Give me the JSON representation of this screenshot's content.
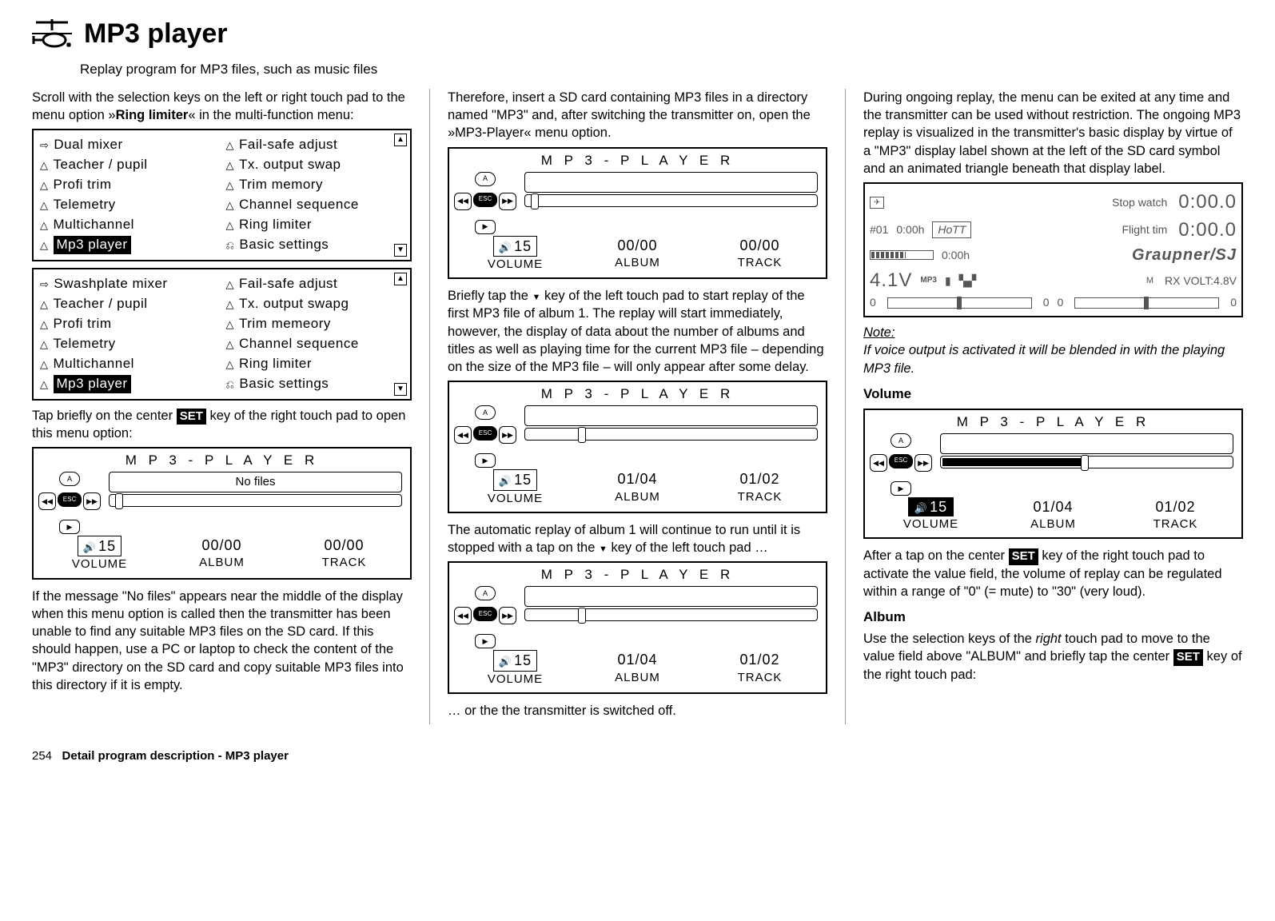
{
  "header": {
    "title": "MP3 player",
    "subtitle": "Replay program for MP3 files, such as music files"
  },
  "col1": {
    "p1a": "Scroll with the selection keys on the left or right touch pad to the menu option »",
    "p1b": "Ring limiter",
    "p1c": "« in the multi-function menu:",
    "menu1": {
      "left": [
        {
          "icon": "mix",
          "label": "Dual mixer"
        },
        {
          "icon": "tri",
          "label": "Teacher / pupil"
        },
        {
          "icon": "tri",
          "label": "Profi trim"
        },
        {
          "icon": "tri",
          "label": "Telemetry"
        },
        {
          "icon": "tri",
          "label": "Multichannel"
        },
        {
          "icon": "tri",
          "label": "Mp3  player",
          "hl": true
        }
      ],
      "right": [
        {
          "icon": "tri",
          "label": "Fail-safe adjust"
        },
        {
          "icon": "tri",
          "label": "Tx. output swap"
        },
        {
          "icon": "tri",
          "label": "Trim memory"
        },
        {
          "icon": "tri",
          "label": "Channel sequence"
        },
        {
          "icon": "tri",
          "label": "Ring limiter"
        },
        {
          "icon": "sq",
          "label": "Basic settings"
        }
      ]
    },
    "menu2": {
      "left": [
        {
          "icon": "mix",
          "label": "Swashplate mixer"
        },
        {
          "icon": "tri",
          "label": "Teacher / pupil"
        },
        {
          "icon": "tri",
          "label": "Profi trim"
        },
        {
          "icon": "tri",
          "label": "Telemetry"
        },
        {
          "icon": "tri",
          "label": "Multichannel"
        },
        {
          "icon": "tri",
          "label": "Mp3  player",
          "hl": true
        }
      ],
      "right": [
        {
          "icon": "tri",
          "label": "Fail-safe adjust"
        },
        {
          "icon": "tri",
          "label": "Tx. output swapg"
        },
        {
          "icon": "tri",
          "label": "Trim memeory"
        },
        {
          "icon": "tri",
          "label": "Channel sequence"
        },
        {
          "icon": "tri",
          "label": "Ring limiter"
        },
        {
          "icon": "sq",
          "label": "Basic settings"
        }
      ]
    },
    "p2a": "Tap briefly on the center ",
    "p2b": " key of the right touch pad to open this menu option:",
    "lcd1": {
      "title": "M P 3 - P L A Y E R",
      "msg": "No files",
      "vol": "15",
      "volLbl": "VOLUME",
      "alb": "00/00",
      "albLbl": "ALBUM",
      "trk": "00/00",
      "trkLbl": "TRACK",
      "knob": 2
    },
    "p3": "If the message \"No files\" appears near the middle of the display when this menu option is called then the transmitter has been unable to find any suitable MP3 files on the SD card. If this should happen, use a PC or laptop to check the content of the \"MP3\" directory on the SD card and copy suitable MP3 files into this directory if it is empty."
  },
  "col2": {
    "p1": "Therefore, insert a SD card containing MP3 files in a directory named \"MP3\" and, after switching the transmitter on, open the »MP3-Player« menu option.",
    "lcd2": {
      "title": "M P 3 - P L A Y E R",
      "vol": "15",
      "volLbl": "VOLUME",
      "alb": "00/00",
      "albLbl": "ALBUM",
      "trk": "00/00",
      "trkLbl": "TRACK",
      "knob": 2
    },
    "p2a": "Briefly tap the ",
    "p2b": " key of the left touch pad to start replay of the first MP3 file of album 1. The replay will start immediately, however, the display of data about the number of albums and titles as well as playing time for the current MP3 file – depending on the size of the MP3 file – will only appear after some delay.",
    "lcd3": {
      "title": "M P 3 - P L A Y E R",
      "vol": "15",
      "volLbl": "VOLUME",
      "alb": "01/04",
      "albLbl": "ALBUM",
      "trk": "01/02",
      "trkLbl": "TRACK",
      "knob": 18
    },
    "p3a": "The automatic replay of album 1 will continue to run until it is stopped with a tap on the ",
    "p3b": " key of the left touch pad …",
    "lcd4": {
      "title": "M P 3 - P L A Y E R",
      "vol": "15",
      "volLbl": "VOLUME",
      "alb": "01/04",
      "albLbl": "ALBUM",
      "trk": "01/02",
      "trkLbl": "TRACK",
      "knob": 18
    },
    "p4": "… or the the transmitter is switched off."
  },
  "col3": {
    "p1": "During ongoing replay, the menu can be exited at any time and the transmitter can be used without restriction. The ongoing MP3 replay is visualized in the transmitter's basic display by virtue of a \"MP3\" display label shown at the left of the SD card symbol and an animated triangle beneath that display label.",
    "tx": {
      "stop": "Stop watch",
      "stopv": "0:00.0",
      "flight": "Flight tim",
      "flightv": "0:00.0",
      "mdl": "#01",
      "t1": "0:00h",
      "t2": "0:00h",
      "volt": "4.1V",
      "mp3": "MP3",
      "brand": "Graupner/SJ",
      "rx": "RX VOLT:4.8V",
      "zero": "0"
    },
    "noteLbl": "Note:",
    "note": "If voice output is activated it will be blended in with the playing MP3 file.",
    "volHdr": "Volume",
    "lcd5": {
      "title": "M P 3 - P L A Y E R",
      "vol": "15",
      "volLbl": "VOLUME",
      "alb": "01/04",
      "albLbl": "ALBUM",
      "trk": "01/02",
      "trkLbl": "TRACK",
      "fill": 48,
      "knob": 48
    },
    "p2a": "After a tap on the center ",
    "p2b": " key of the right touch pad to activate the value field, the volume of replay can be regulated within a range of \"0\" (= mute) to \"30\" (very loud).",
    "albHdr": "Album",
    "p3a": "Use the selection keys of the ",
    "p3i": "right",
    "p3b": " touch pad to move to the value field above \"ALBUM\" and briefly tap the center ",
    "p3c": " key of the right touch pad:"
  },
  "set": "SET",
  "esc": "ESC",
  "dpadUp": "A",
  "footer": {
    "page": "254",
    "text": "Detail program description - MP3 player"
  }
}
